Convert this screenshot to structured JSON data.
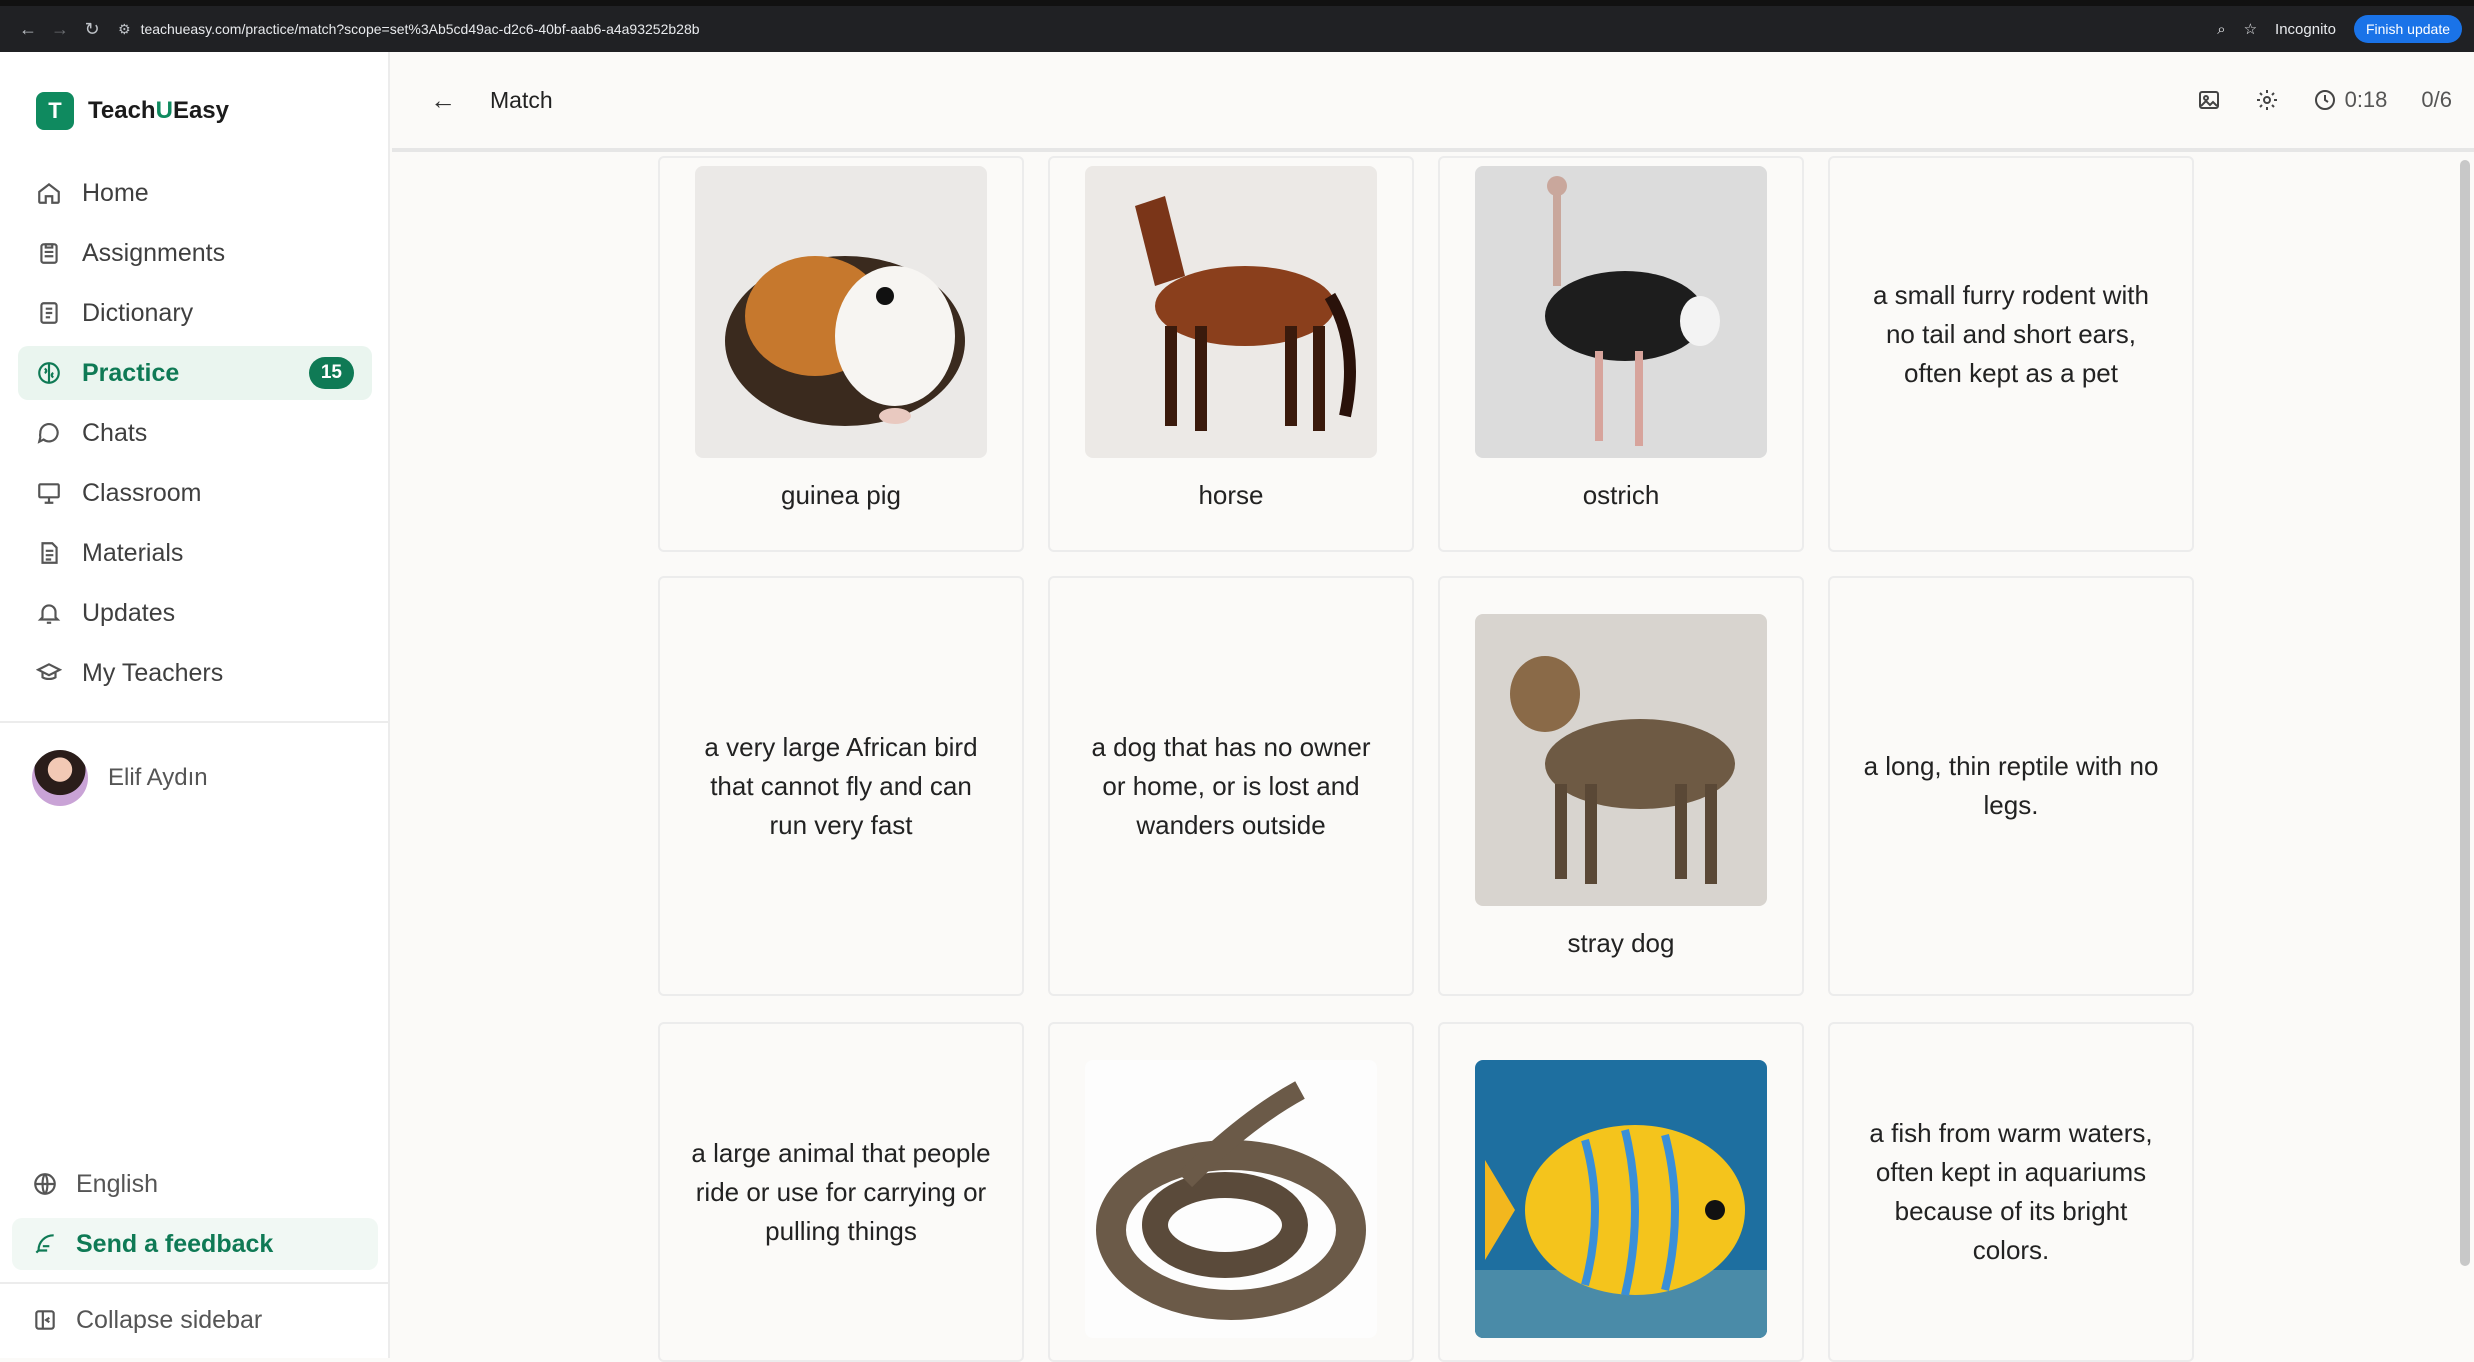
{
  "browser": {
    "url": "teachueasy.com/practice/match?scope=set%3Ab5cd49ac-d2c6-40bf-aab6-a4a93252b28b",
    "incognito": "Incognito",
    "finish_update": "Finish update"
  },
  "brand": {
    "mark": "T",
    "name_a": "Teach",
    "name_b": "U",
    "name_c": "Easy"
  },
  "sidebar": {
    "items": [
      {
        "label": "Home",
        "icon": "home-icon"
      },
      {
        "label": "Assignments",
        "icon": "clipboard-icon"
      },
      {
        "label": "Dictionary",
        "icon": "book-icon"
      },
      {
        "label": "Practice",
        "icon": "brain-icon",
        "badge": "15",
        "active": true
      },
      {
        "label": "Chats",
        "icon": "chat-icon"
      },
      {
        "label": "Classroom",
        "icon": "board-icon"
      },
      {
        "label": "Materials",
        "icon": "document-icon"
      },
      {
        "label": "Updates",
        "icon": "bell-icon"
      },
      {
        "label": "My Teachers",
        "icon": "graduation-cap-icon"
      }
    ],
    "user": "Elif Aydın",
    "language": "English",
    "feedback": "Send a feedback",
    "collapse": "Collapse sidebar"
  },
  "header": {
    "title": "Match",
    "timer": "0:18",
    "progress": "0/6"
  },
  "cards": [
    {
      "type": "image",
      "word": "guinea pig",
      "image": "guinea-pig"
    },
    {
      "type": "image",
      "word": "horse",
      "image": "horse"
    },
    {
      "type": "image",
      "word": "ostrich",
      "image": "ostrich"
    },
    {
      "type": "text",
      "text": "a small furry rodent with no tail and short ears, often kept as a pet"
    },
    {
      "type": "text",
      "text": "a very large African bird that cannot fly and can run very fast"
    },
    {
      "type": "text",
      "text": "a dog that has no owner or home, or is lost and wanders outside"
    },
    {
      "type": "image",
      "word": "stray dog",
      "image": "stray-dog"
    },
    {
      "type": "text",
      "text": "a long, thin reptile with no legs."
    },
    {
      "type": "text",
      "text": "a large animal that people ride or use for carrying or pulling things"
    },
    {
      "type": "image",
      "word": "",
      "image": "snake"
    },
    {
      "type": "image",
      "word": "",
      "image": "tropical-fish"
    },
    {
      "type": "text",
      "text": "a fish from warm waters, often kept in aquariums because of its bright colors."
    }
  ]
}
